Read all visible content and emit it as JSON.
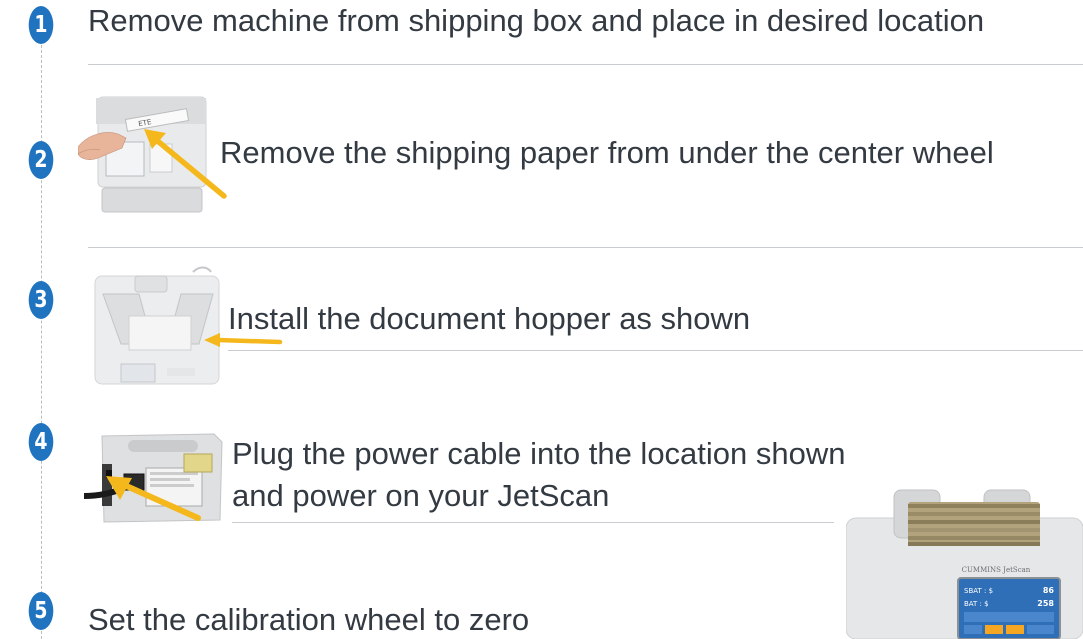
{
  "steps": [
    {
      "number": "1",
      "text": "Remove machine from shipping box and place in desired location"
    },
    {
      "number": "2",
      "text": "Remove the shipping paper from under the center wheel"
    },
    {
      "number": "3",
      "text": "Install the document hopper as shown"
    },
    {
      "number": "4",
      "text_line1": "Plug the power cable into the location shown",
      "text_line2": "and power on your JetScan"
    },
    {
      "number": "5",
      "text": "Set the calibration wheel to zero"
    }
  ],
  "product_photo": {
    "brand_label": "CUMMINS JetScan",
    "screen_row1_label": "SBAT : $",
    "screen_row1_value": "86",
    "screen_row2_label": "BAT : $",
    "screen_row2_value": "258"
  },
  "colors": {
    "badge": "#1f73bf",
    "arrow": "#f5b81c",
    "text": "#333a42",
    "divider": "#c9ccd0"
  }
}
